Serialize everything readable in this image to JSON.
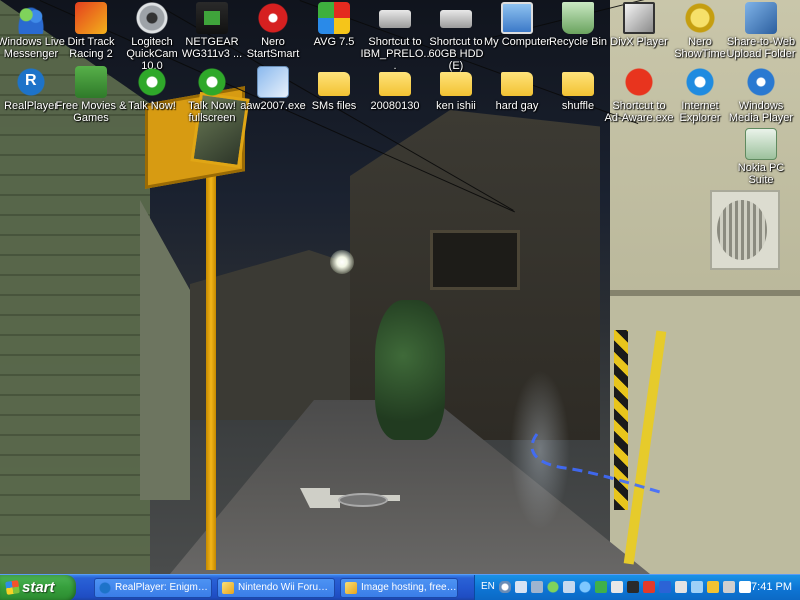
{
  "desktop": {
    "icons": [
      {
        "label": "Windows Live Messenger",
        "icon": "messenger-icon"
      },
      {
        "label": "Dirt Track Racing 2",
        "icon": "game-icon"
      },
      {
        "label": "Logitech QuickCam 10.0",
        "icon": "webcam-icon"
      },
      {
        "label": "NETGEAR WG311v3 ...",
        "icon": "network-card-icon"
      },
      {
        "label": "Nero StartSmart",
        "icon": "nero-icon"
      },
      {
        "label": "AVG 7.5",
        "icon": "antivirus-icon"
      },
      {
        "label": "Shortcut to IBM_PRELO...",
        "icon": "drive-icon"
      },
      {
        "label": "Shortcut to 60GB HDD (E)",
        "icon": "drive-icon"
      },
      {
        "label": "My Computer",
        "icon": "computer-icon"
      },
      {
        "label": "Recycle Bin",
        "icon": "recycle-bin-icon"
      },
      {
        "label": "DivX Player",
        "icon": "divx-icon"
      },
      {
        "label": "Nero ShowTime",
        "icon": "showtime-icon"
      },
      {
        "label": "Share-to-Web Upload Folder",
        "icon": "share-folder-icon"
      },
      {
        "label": "RealPlayer",
        "icon": "realplayer-icon"
      },
      {
        "label": "Free Movies & Games",
        "icon": "movies-icon"
      },
      {
        "label": "Talk Now!",
        "icon": "talk-icon"
      },
      {
        "label": "Talk Now! fullscreen",
        "icon": "talk-icon"
      },
      {
        "label": "aaw2007.exe",
        "icon": "exe-icon"
      },
      {
        "label": "SMs files",
        "icon": "folder-icon"
      },
      {
        "label": "20080130",
        "icon": "folder-icon"
      },
      {
        "label": "ken ishii",
        "icon": "folder-icon"
      },
      {
        "label": "hard gay",
        "icon": "folder-icon"
      },
      {
        "label": "shuffle",
        "icon": "folder-icon"
      },
      {
        "label": "Shortcut to Ad-Aware.exe",
        "icon": "adaware-icon"
      },
      {
        "label": "Internet Explorer",
        "icon": "ie-icon"
      },
      {
        "label": "Windows Media Player",
        "icon": "media-player-icon"
      },
      {
        "label": "Nokia PC Suite",
        "icon": "nokia-icon"
      }
    ]
  },
  "taskbar": {
    "start_label": "start",
    "tasks": [
      {
        "label": "RealPlayer: Enigma, ...",
        "icon": "realplayer-icon"
      },
      {
        "label": "Nintendo Wii Forum - ...",
        "icon": "browser-icon"
      },
      {
        "label": "Image hosting, free p...",
        "icon": "browser-icon"
      }
    ],
    "language": "EN",
    "clock": "7:41 PM"
  },
  "colors": {
    "taskbar_blue": "#2457cf",
    "start_green": "#37a03d",
    "tray_blue": "#0e76d5"
  }
}
